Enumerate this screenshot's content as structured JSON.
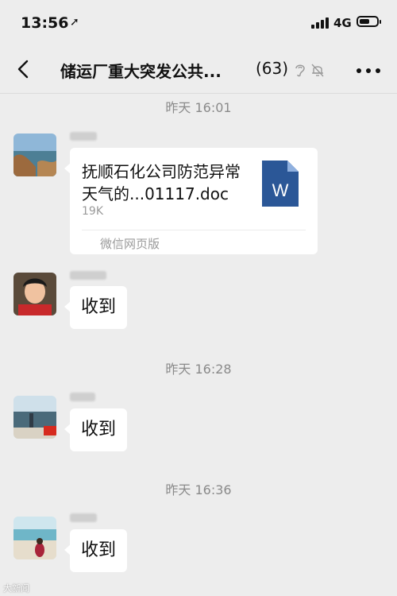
{
  "status_bar": {
    "time": "13:56",
    "network": "4G"
  },
  "header": {
    "title": "储运厂重大突发公共...",
    "member_count": "(63)"
  },
  "messages": [
    {
      "timestamp": "昨天 16:01"
    },
    {
      "type": "file",
      "file_name": "抚顺石化公司防范异常天气的...01117.doc",
      "file_size": "19K",
      "source": "微信网页版",
      "icon_letter": "W"
    },
    {
      "type": "text",
      "text": "收到"
    },
    {
      "timestamp": "昨天 16:28"
    },
    {
      "type": "text",
      "text": "收到"
    },
    {
      "timestamp": "昨天 16:36"
    },
    {
      "type": "text",
      "text": "收到"
    }
  ],
  "watermark": "大新闻",
  "colors": {
    "background": "#ededed",
    "bubble": "#ffffff",
    "doc_icon": "#2b5797"
  }
}
